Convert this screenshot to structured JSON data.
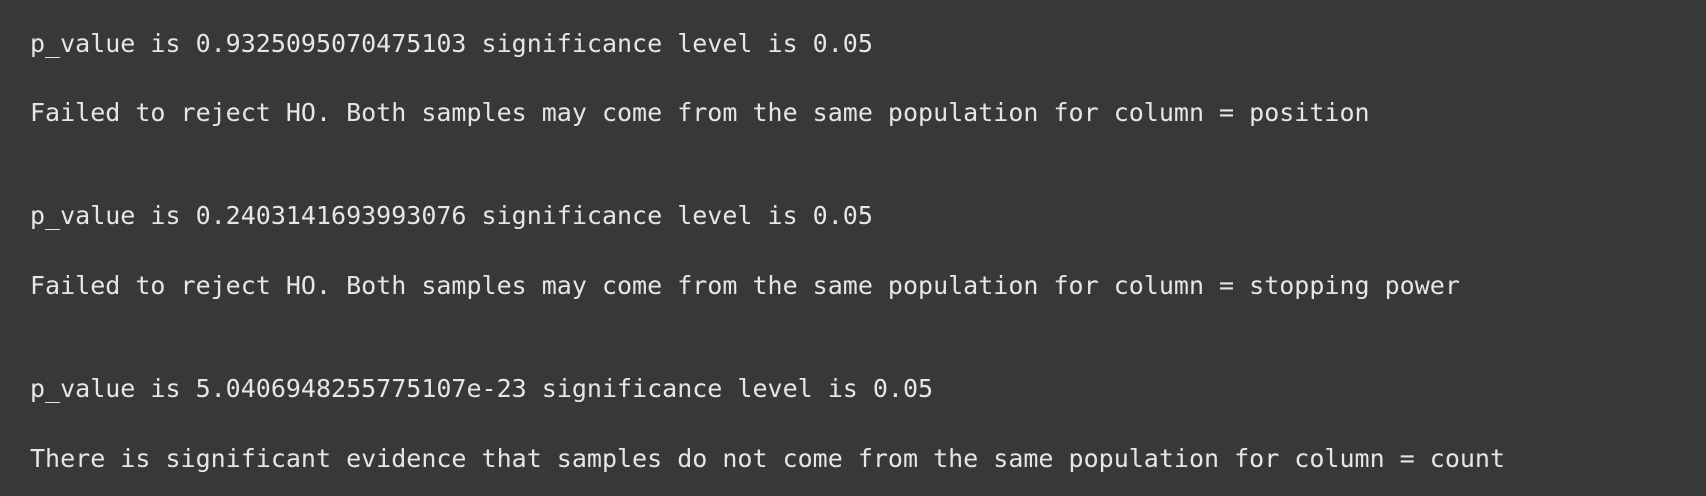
{
  "output": {
    "blocks": [
      {
        "p_value_line": "p_value is 0.9325095070475103 significance level is 0.05",
        "result_line": "Failed to reject HO. Both samples may come from the same population for column = position"
      },
      {
        "p_value_line": "p_value is 0.2403141693993076 significance level is 0.05",
        "result_line": "Failed to reject HO. Both samples may come from the same population for column = stopping power"
      },
      {
        "p_value_line": "p_value is 5.0406948255775107e-23 significance level is 0.05",
        "result_line": "There is significant evidence that samples do not come from the same population for column = count"
      }
    ]
  },
  "colors": {
    "background": "#383838",
    "text": "#e6e6e6"
  }
}
